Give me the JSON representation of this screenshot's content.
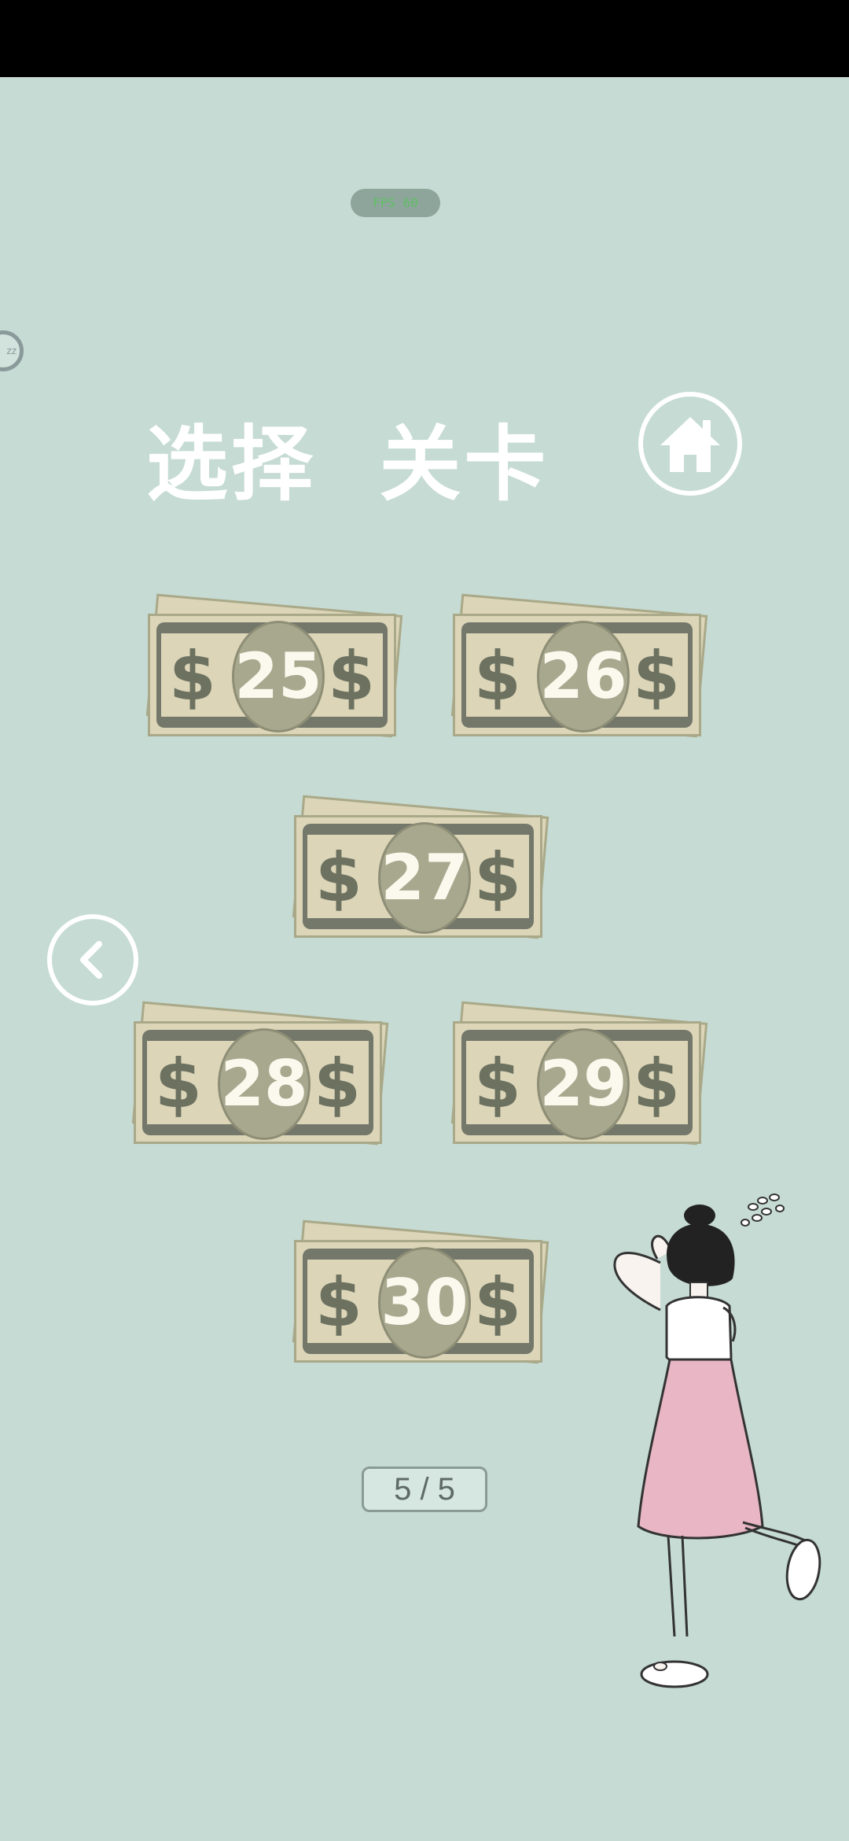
{
  "status_pill": "FPS 60",
  "side_float_label": "zz",
  "title": "选择  关卡",
  "levels": [
    {
      "label": "25",
      "symbol": "$"
    },
    {
      "label": "26",
      "symbol": "$"
    },
    {
      "label": "27",
      "symbol": "$"
    },
    {
      "label": "28",
      "symbol": "$"
    },
    {
      "label": "29",
      "symbol": "$"
    },
    {
      "label": "30",
      "symbol": "$"
    }
  ],
  "page_indicator": "5 / 5",
  "icons": {
    "home": "home-icon",
    "back": "chevron-left-icon"
  },
  "colors": {
    "background": "#c5dbd3",
    "bill": "#dcd5b8",
    "bill_dark": "#73786b",
    "skirt": "#e8b6c4"
  }
}
